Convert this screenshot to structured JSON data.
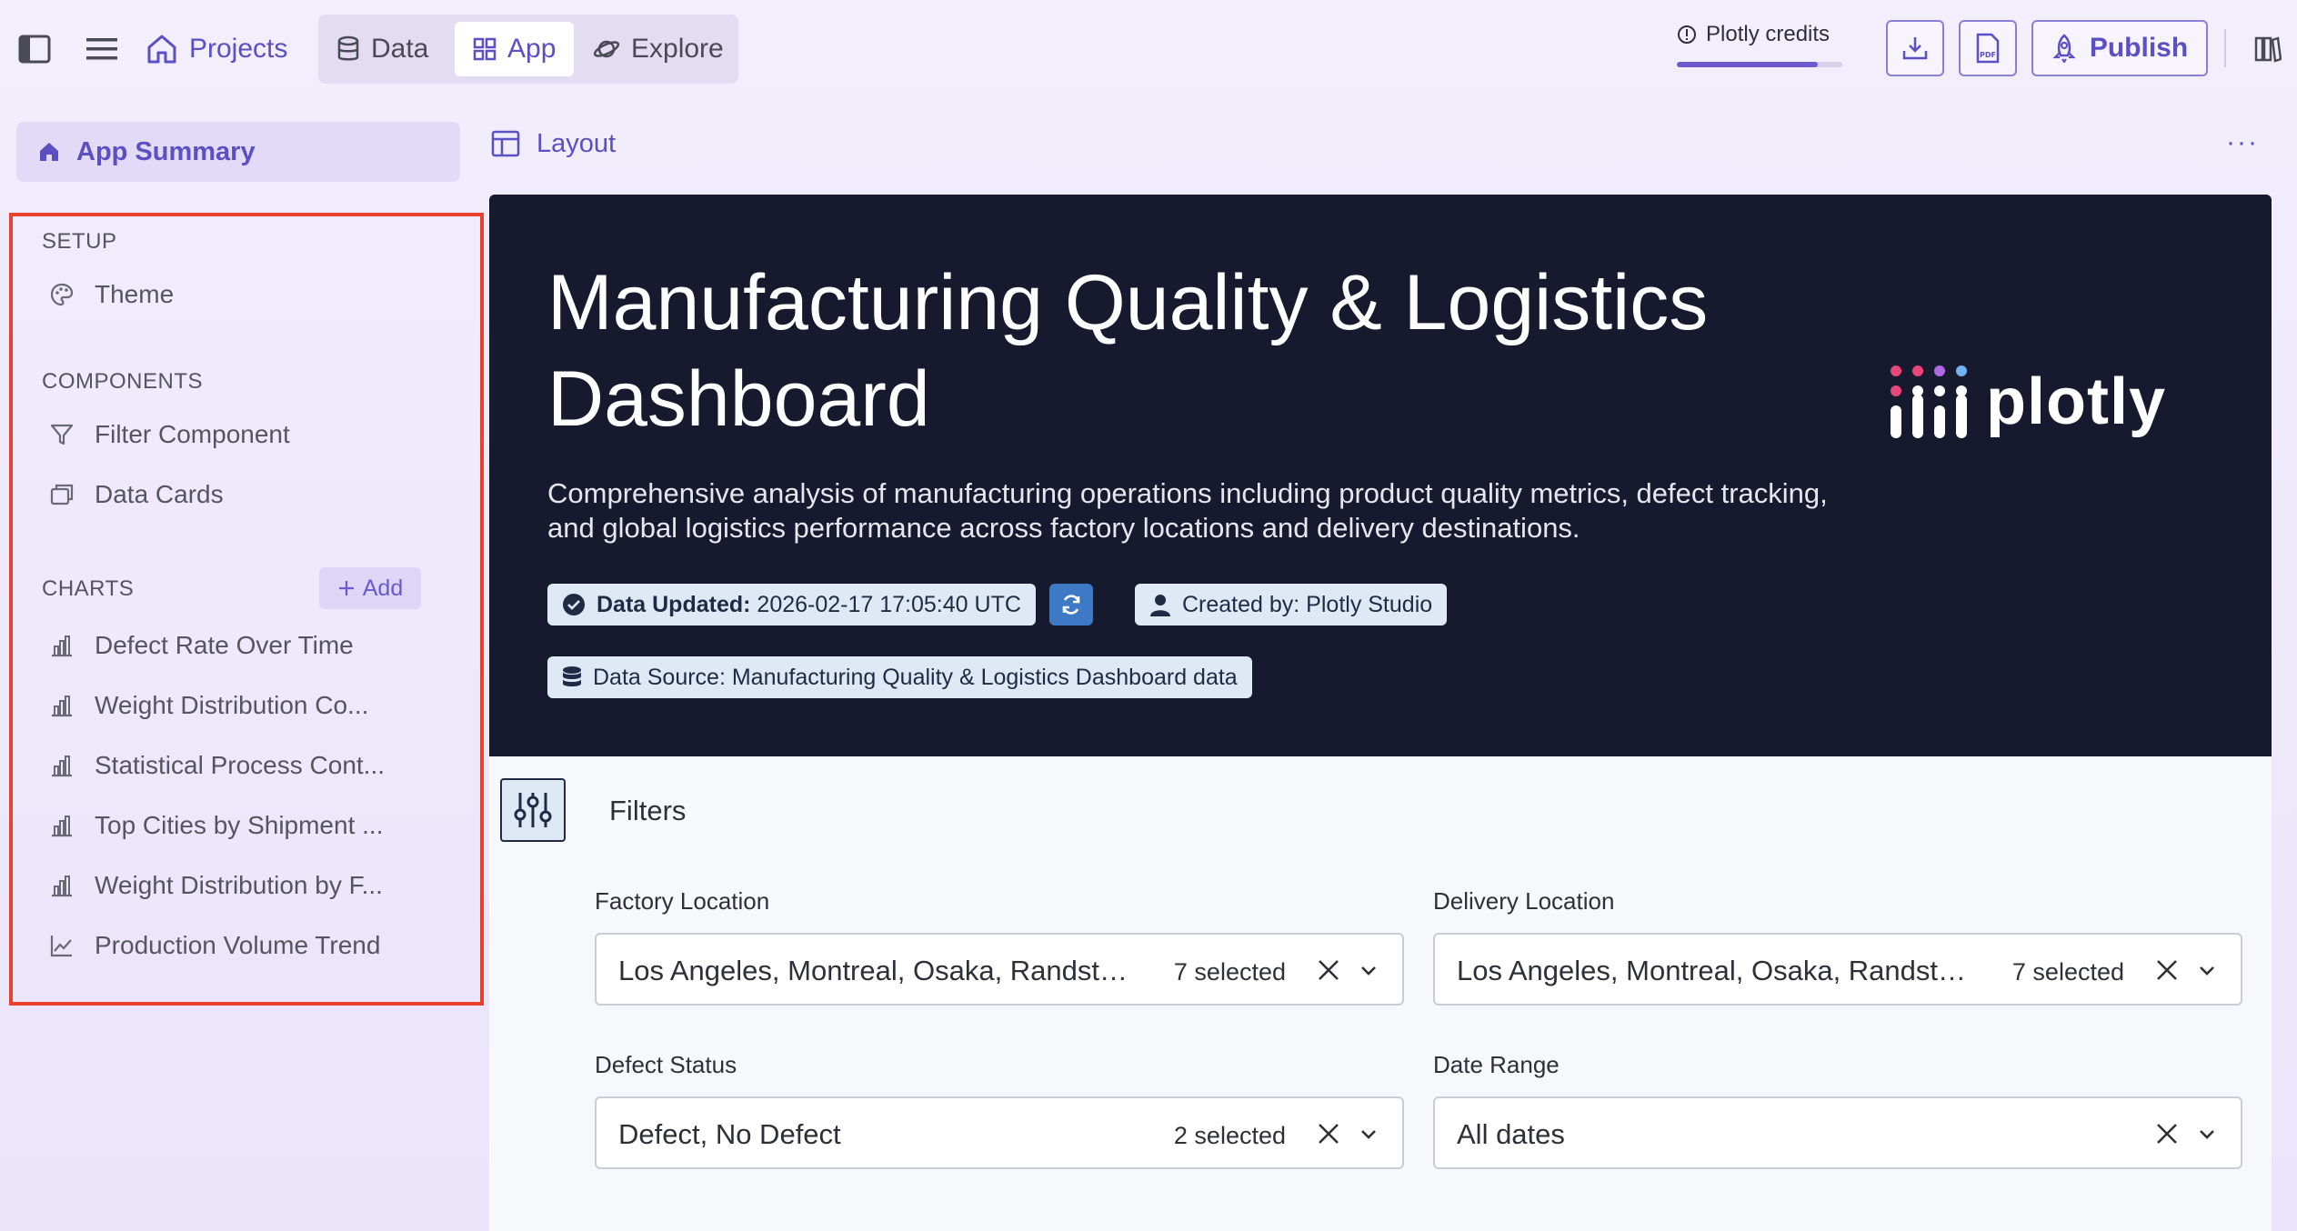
{
  "topbar": {
    "projects_label": "Projects",
    "modes": [
      {
        "label": "Data",
        "icon": "database-icon",
        "active": false
      },
      {
        "label": "App",
        "icon": "grid-icon",
        "active": true
      },
      {
        "label": "Explore",
        "icon": "planet-icon",
        "active": false
      }
    ],
    "credits_label": "Plotly credits",
    "credits_progress": 0.85,
    "publish_label": "Publish"
  },
  "sidebar": {
    "app_summary": "App Summary",
    "setup_header": "SETUP",
    "setup_items": [
      {
        "label": "Theme",
        "icon": "palette-icon"
      }
    ],
    "components_header": "COMPONENTS",
    "components_items": [
      {
        "label": "Filter Component",
        "icon": "filter-icon"
      },
      {
        "label": "Data Cards",
        "icon": "cards-icon"
      }
    ],
    "charts_header": "CHARTS",
    "add_label": "Add",
    "charts_items": [
      {
        "label": "Defect Rate Over Time",
        "icon": "bar-chart-icon"
      },
      {
        "label": "Weight Distribution Co...",
        "icon": "bar-chart-icon"
      },
      {
        "label": "Statistical Process Cont...",
        "icon": "bar-chart-icon"
      },
      {
        "label": "Top Cities by Shipment ...",
        "icon": "bar-chart-icon"
      },
      {
        "label": "Weight Distribution by F...",
        "icon": "bar-chart-icon"
      },
      {
        "label": "Production Volume Trend",
        "icon": "line-chart-icon"
      }
    ]
  },
  "content": {
    "layout_label": "Layout",
    "more_label": "···"
  },
  "hero": {
    "title": "Manufacturing Quality & Logistics Dashboard",
    "description": "Comprehensive analysis of manufacturing operations including product quality metrics, defect tracking, and global logistics performance across factory locations and delivery destinations.",
    "updated_label": "Data Updated:",
    "updated_value": "2026-02-17 17:05:40 UTC",
    "created_by": "Created by: Plotly Studio",
    "data_source": "Data Source: Manufacturing Quality & Logistics Dashboard data",
    "logo_text": "plotly"
  },
  "filters": {
    "title": "Filters",
    "fields": [
      {
        "label": "Factory Location",
        "value": "Los Angeles, Montreal, Osaka, Randstad, Shanghai, Stuttgart, Tijuana",
        "count": "7 selected"
      },
      {
        "label": "Delivery Location",
        "value": "Los Angeles, Montreal, Osaka, Randstad, Shanghai, Stuttgart, Tijuana",
        "count": "7 selected"
      },
      {
        "label": "Defect Status",
        "value": "Defect, No Defect",
        "count": "2 selected"
      },
      {
        "label": "Date Range",
        "value": "All dates",
        "count": ""
      }
    ]
  },
  "colors": {
    "accent": "#5b4fc4",
    "hero_bg": "#171a2e",
    "highlight_border": "#e8422f",
    "badge_bg": "#dfe8f5"
  }
}
